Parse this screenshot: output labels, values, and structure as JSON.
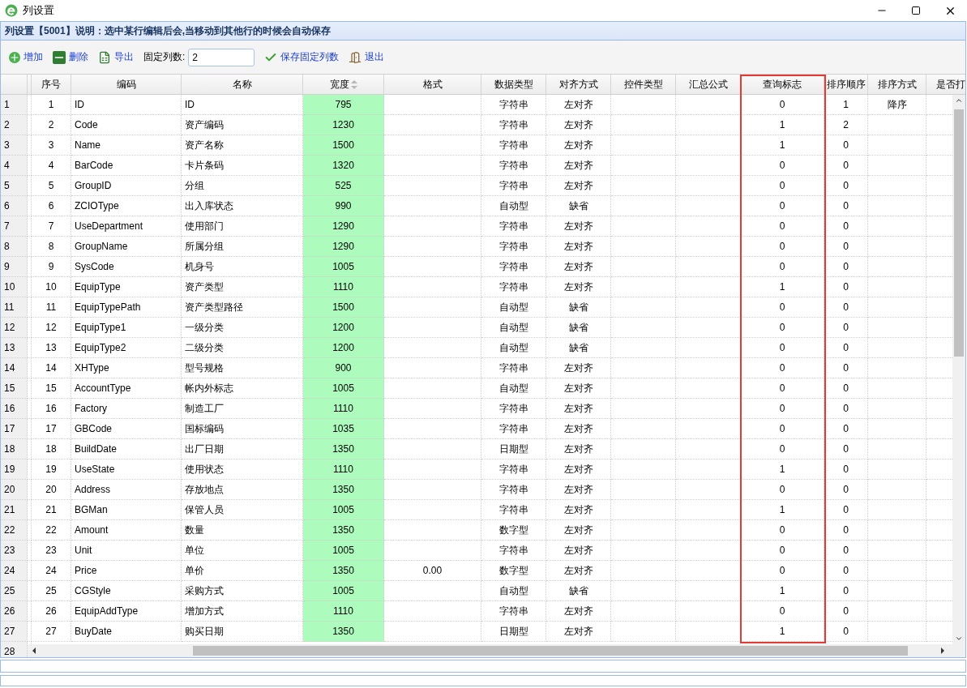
{
  "window": {
    "title": "列设置"
  },
  "panel": {
    "title": "列设置【5001】说明：选中某行编辑后会,当移动到其他行的时候会自动保存"
  },
  "toolbar": {
    "buttons": [
      {
        "kind": "add",
        "label": "增加"
      },
      {
        "kind": "delete",
        "label": "删除"
      },
      {
        "kind": "export",
        "label": "导出"
      }
    ],
    "fixed_columns": {
      "label": "固定列数:",
      "value": "2"
    },
    "actions": [
      {
        "kind": "save",
        "label": "保存固定列数"
      },
      {
        "kind": "exit",
        "label": "退出"
      }
    ]
  },
  "table": {
    "columns": [
      {
        "label": "序号"
      },
      {
        "label": "编码"
      },
      {
        "label": "名称"
      },
      {
        "label": "宽度",
        "sortable": true,
        "color": "#adfcbe"
      },
      {
        "label": "格式"
      },
      {
        "label": "数据类型"
      },
      {
        "label": "对齐方式"
      },
      {
        "label": "控件类型"
      },
      {
        "label": "汇总公式"
      },
      {
        "label": "查询标志",
        "highlighted": true
      },
      {
        "label": "排序顺序"
      },
      {
        "label": "排序方式"
      },
      {
        "label": "是否打"
      }
    ],
    "rows": [
      {
        "number": "1",
        "cells": [
          "1",
          "ID",
          "ID",
          "795",
          null,
          "字符串",
          "左对齐",
          null,
          null,
          "0",
          "1",
          "降序",
          null
        ]
      },
      {
        "number": "2",
        "cells": [
          "2",
          "Code",
          "资产编码",
          "1230",
          null,
          "字符串",
          "左对齐",
          null,
          null,
          "1",
          "2",
          null,
          null
        ]
      },
      {
        "number": "3",
        "cells": [
          "3",
          "Name",
          "资产名称",
          "1500",
          null,
          "字符串",
          "左对齐",
          null,
          null,
          "1",
          "0",
          null,
          null
        ]
      },
      {
        "number": "4",
        "cells": [
          "4",
          "BarCode",
          "卡片条码",
          "1320",
          null,
          "字符串",
          "左对齐",
          null,
          null,
          "0",
          "0",
          null,
          null
        ]
      },
      {
        "number": "5",
        "cells": [
          "5",
          "GroupID",
          "分组",
          "525",
          null,
          "字符串",
          "左对齐",
          null,
          null,
          "0",
          "0",
          null,
          null
        ]
      },
      {
        "number": "6",
        "cells": [
          "6",
          "ZCIOType",
          "出入库状态",
          "990",
          null,
          "自动型",
          "缺省",
          null,
          null,
          "0",
          "0",
          null,
          null
        ]
      },
      {
        "number": "7",
        "cells": [
          "7",
          "UseDepartment",
          "使用部门",
          "1290",
          null,
          "字符串",
          "左对齐",
          null,
          null,
          "0",
          "0",
          null,
          null
        ]
      },
      {
        "number": "8",
        "cells": [
          "8",
          "GroupName",
          "所属分组",
          "1290",
          null,
          "字符串",
          "左对齐",
          null,
          null,
          "0",
          "0",
          null,
          null
        ]
      },
      {
        "number": "9",
        "cells": [
          "9",
          "SysCode",
          "机身号",
          "1005",
          null,
          "字符串",
          "左对齐",
          null,
          null,
          "0",
          "0",
          null,
          null
        ]
      },
      {
        "number": "10",
        "cells": [
          "10",
          "EquipType",
          "资产类型",
          "1110",
          null,
          "字符串",
          "左对齐",
          null,
          null,
          "1",
          "0",
          null,
          null
        ]
      },
      {
        "number": "11",
        "cells": [
          "11",
          "EquipTypePath",
          "资产类型路径",
          "1500",
          null,
          "自动型",
          "缺省",
          null,
          null,
          "0",
          "0",
          null,
          null
        ]
      },
      {
        "number": "12",
        "cells": [
          "12",
          "EquipType1",
          "一级分类",
          "1200",
          null,
          "自动型",
          "缺省",
          null,
          null,
          "0",
          "0",
          null,
          null
        ]
      },
      {
        "number": "13",
        "cells": [
          "13",
          "EquipType2",
          "二级分类",
          "1200",
          null,
          "自动型",
          "缺省",
          null,
          null,
          "0",
          "0",
          null,
          null
        ]
      },
      {
        "number": "14",
        "cells": [
          "14",
          "XHType",
          "型号规格",
          "900",
          null,
          "字符串",
          "左对齐",
          null,
          null,
          "0",
          "0",
          null,
          null
        ]
      },
      {
        "number": "15",
        "cells": [
          "15",
          "AccountType",
          "帐内外标志",
          "1005",
          null,
          "自动型",
          "左对齐",
          null,
          null,
          "0",
          "0",
          null,
          null
        ]
      },
      {
        "number": "16",
        "cells": [
          "16",
          "Factory",
          "制造工厂",
          "1110",
          null,
          "字符串",
          "左对齐",
          null,
          null,
          "0",
          "0",
          null,
          null
        ]
      },
      {
        "number": "17",
        "cells": [
          "17",
          "GBCode",
          "国标编码",
          "1035",
          null,
          "字符串",
          "左对齐",
          null,
          null,
          "0",
          "0",
          null,
          null
        ]
      },
      {
        "number": "18",
        "cells": [
          "18",
          "BuildDate",
          "出厂日期",
          "1350",
          null,
          "日期型",
          "左对齐",
          null,
          null,
          "0",
          "0",
          null,
          null
        ]
      },
      {
        "number": "19",
        "cells": [
          "19",
          "UseState",
          "使用状态",
          "1110",
          null,
          "字符串",
          "左对齐",
          null,
          null,
          "1",
          "0",
          null,
          null
        ]
      },
      {
        "number": "20",
        "cells": [
          "20",
          "Address",
          "存放地点",
          "1350",
          null,
          "字符串",
          "左对齐",
          null,
          null,
          "0",
          "0",
          null,
          null
        ]
      },
      {
        "number": "21",
        "cells": [
          "21",
          "BGMan",
          "保管人员",
          "1005",
          null,
          "字符串",
          "左对齐",
          null,
          null,
          "1",
          "0",
          null,
          null
        ]
      },
      {
        "number": "22",
        "cells": [
          "22",
          "Amount",
          "数量",
          "1350",
          null,
          "数字型",
          "左对齐",
          null,
          null,
          "0",
          "0",
          null,
          null
        ]
      },
      {
        "number": "23",
        "cells": [
          "23",
          "Unit",
          "单位",
          "1005",
          null,
          "字符串",
          "左对齐",
          null,
          null,
          "0",
          "0",
          null,
          null
        ]
      },
      {
        "number": "24",
        "cells": [
          "24",
          "Price",
          "单价",
          "1350",
          "0.00",
          "数字型",
          "左对齐",
          null,
          null,
          "0",
          "0",
          null,
          null
        ]
      },
      {
        "number": "25",
        "cells": [
          "25",
          "CGStyle",
          "采购方式",
          "1005",
          null,
          "自动型",
          "缺省",
          null,
          null,
          "1",
          "0",
          null,
          null
        ]
      },
      {
        "number": "26",
        "cells": [
          "26",
          "EquipAddType",
          "增加方式",
          "1110",
          null,
          "字符串",
          "左对齐",
          null,
          null,
          "0",
          "0",
          null,
          null
        ]
      },
      {
        "number": "27",
        "cells": [
          "27",
          "BuyDate",
          "购买日期",
          "1350",
          null,
          "日期型",
          "左对齐",
          null,
          null,
          "1",
          "0",
          null,
          null
        ]
      },
      {
        "number": "28"
      }
    ]
  }
}
